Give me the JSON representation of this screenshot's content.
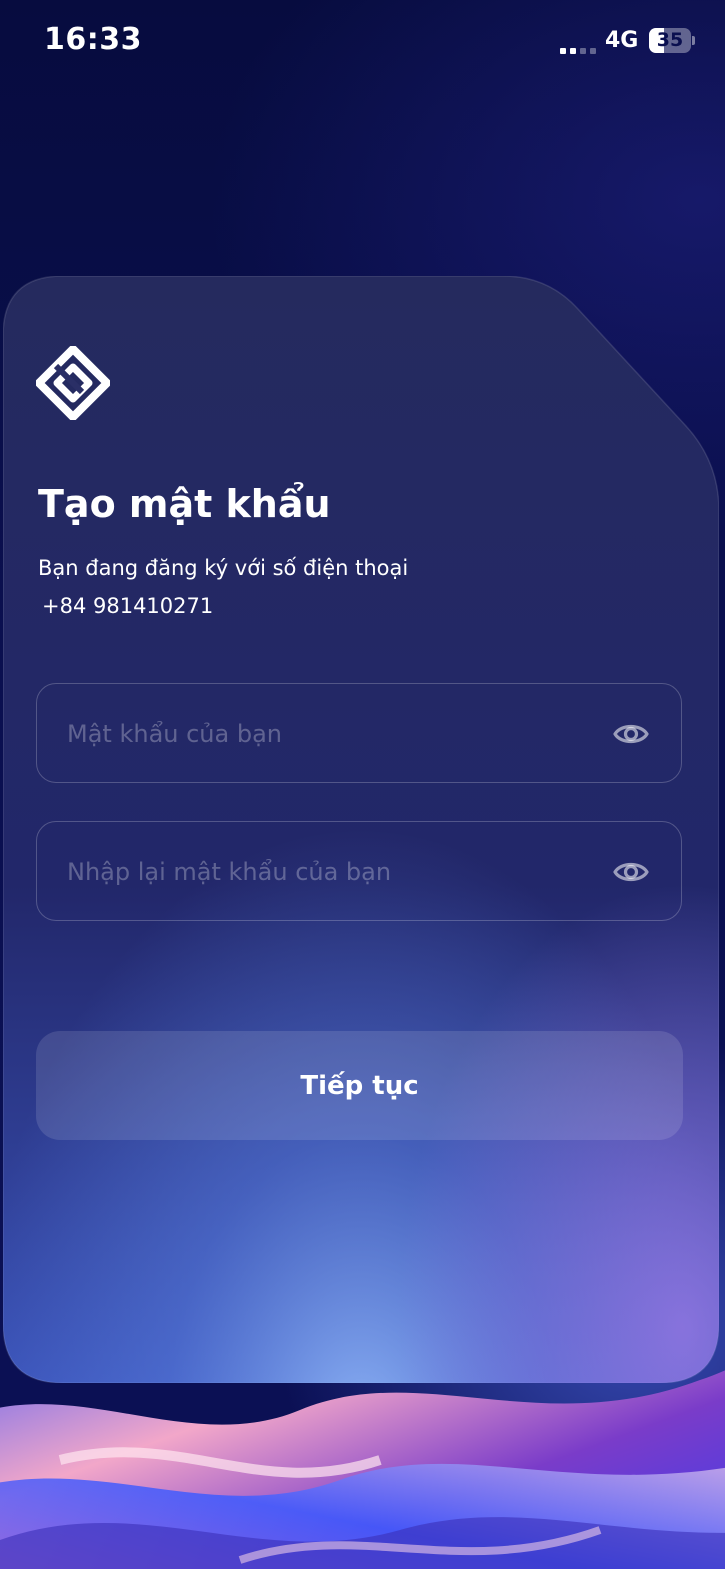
{
  "status_bar": {
    "time": "16:33",
    "network": "4G",
    "battery": "35",
    "battery_level": 0.35
  },
  "form": {
    "title": "Tạo mật khẩu",
    "subtitle": "Bạn đang đăng ký với số điện thoại",
    "phone": "+84 981410271",
    "password_placeholder": "Mật khẩu của bạn",
    "confirm_placeholder": "Nhập lại mật khẩu của bạn",
    "continue_label": "Tiếp tục"
  },
  "icons": {
    "logo": "diamond-logo-icon",
    "password_toggle": "eye-icon",
    "confirm_toggle": "eye-icon"
  },
  "colors": {
    "background": "#0a0f4f",
    "text": "#ffffff",
    "placeholder": "#6f7192"
  }
}
